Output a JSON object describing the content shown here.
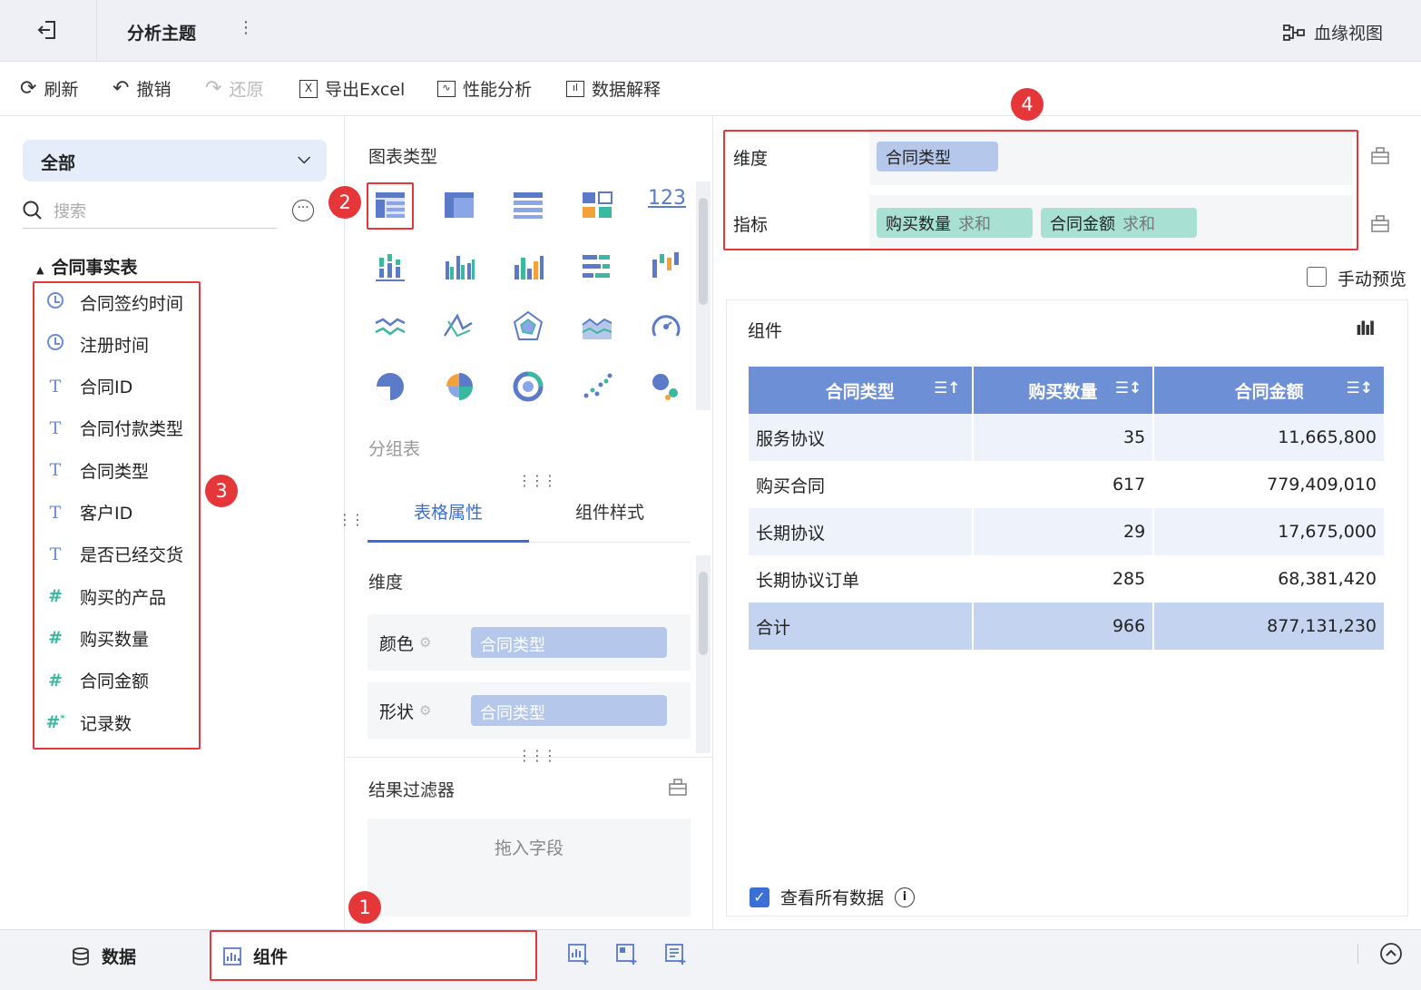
{
  "header": {
    "title": "分析主题",
    "lineage": "血缘视图"
  },
  "toolbar": {
    "refresh": "刷新",
    "undo": "撤销",
    "redo": "还原",
    "export": "导出Excel",
    "perf": "性能分析",
    "explain": "数据解释"
  },
  "left": {
    "scope": "全部",
    "search_placeholder": "搜索",
    "table_name": "合同事实表",
    "fields": [
      {
        "label": "合同签约时间",
        "type": "date"
      },
      {
        "label": "注册时间",
        "type": "date"
      },
      {
        "label": "合同ID",
        "type": "text"
      },
      {
        "label": "合同付款类型",
        "type": "text"
      },
      {
        "label": "合同类型",
        "type": "text"
      },
      {
        "label": "客户ID",
        "type": "text"
      },
      {
        "label": "是否已经交货",
        "type": "text"
      },
      {
        "label": "购买的产品",
        "type": "number"
      },
      {
        "label": "购买数量",
        "type": "number"
      },
      {
        "label": "合同金额",
        "type": "number"
      },
      {
        "label": "记录数",
        "type": "number-calc"
      }
    ]
  },
  "middle": {
    "chart_type_title": "图表类型",
    "chart_selected_name": "分组表",
    "tabs": [
      "表格属性",
      "组件样式"
    ],
    "dimension_label": "维度",
    "color_label": "颜色",
    "color_value": "合同类型",
    "shape_label": "形状",
    "shape_value": "合同类型",
    "filter_title": "结果过滤器",
    "filter_placeholder": "拖入字段"
  },
  "right": {
    "dimension_label": "维度",
    "dimension_pill": "合同类型",
    "measure_label": "指标",
    "measures": [
      {
        "name": "购买数量",
        "agg": "求和"
      },
      {
        "name": "合同金额",
        "agg": "求和"
      }
    ],
    "manual_preview": "手动预览",
    "card_title": "组件",
    "columns": [
      "合同类型",
      "购买数量",
      "合同金额"
    ],
    "rows": [
      [
        "服务协议",
        "35",
        "11,665,800"
      ],
      [
        "购买合同",
        "617",
        "779,409,010"
      ],
      [
        "长期协议",
        "29",
        "17,675,000"
      ],
      [
        "长期协议订单",
        "285",
        "68,381,420"
      ]
    ],
    "total": [
      "合计",
      "966",
      "877,131,230"
    ],
    "view_all": "查看所有数据"
  },
  "bottom": {
    "data_tab": "数据",
    "component_tab": "组件"
  },
  "badges": [
    "1",
    "2",
    "3",
    "4"
  ],
  "colors": {
    "accent": "#3a6fd8",
    "annotation": "#e5373a",
    "dim_pill": "#b5c7ea",
    "measure_pill": "#a9e0d4",
    "table_header": "#6d8fd6"
  }
}
